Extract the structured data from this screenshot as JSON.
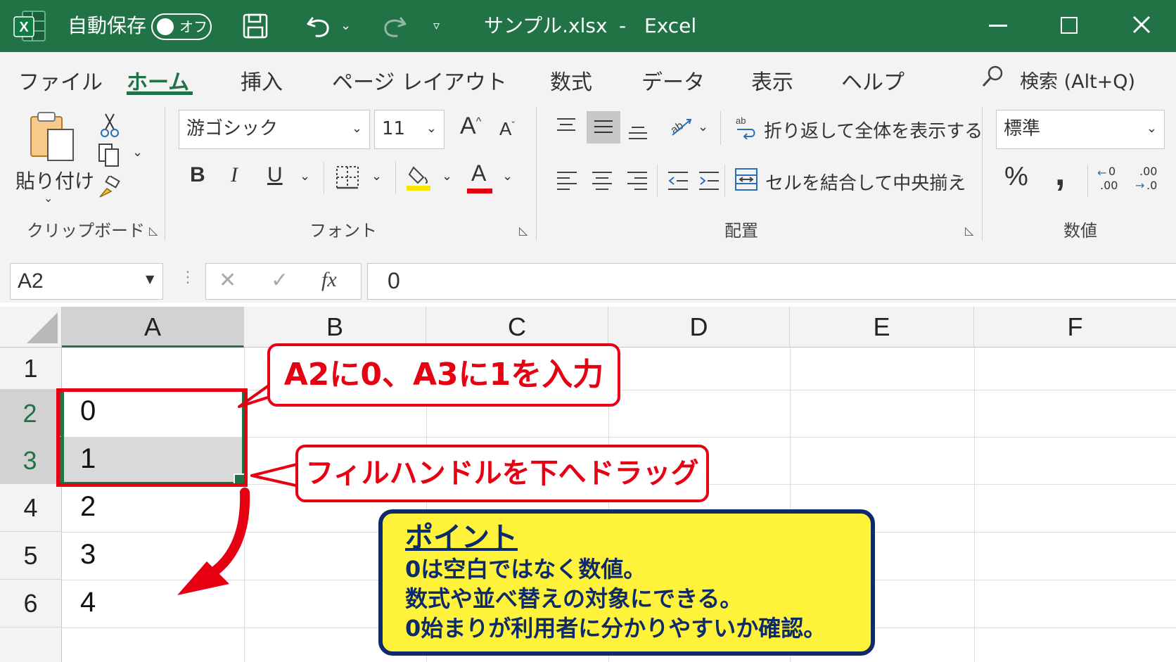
{
  "titlebar": {
    "autosave_label": "自動保存",
    "autosave_state": "オフ",
    "filename": "サンプル.xlsx",
    "separator": "-",
    "app": "Excel"
  },
  "tabs": [
    "ファイル",
    "ホーム",
    "挿入",
    "ページ レイアウト",
    "数式",
    "データ",
    "表示",
    "ヘルプ"
  ],
  "active_tab": "ホーム",
  "search_label": "検索 (Alt+Q)",
  "ribbon": {
    "clipboard": {
      "paste_label": "貼り付け",
      "group_label": "クリップボード"
    },
    "font": {
      "font_name": "游ゴシック",
      "font_size": "11",
      "group_label": "フォント",
      "bold": "B",
      "italic": "I",
      "underline": "U",
      "font_color_letter": "A",
      "highlight_color": "#f6e600",
      "font_color": "#e60012"
    },
    "alignment": {
      "wrap_text": "折り返して全体を表示する",
      "merge_center": "セルを結合して中央揃え",
      "group_label": "配置"
    },
    "number": {
      "format": "標準",
      "percent": "%",
      "comma": ",",
      "dec_inc": ".00",
      "dec_dec": ".0",
      "group_label": "数値"
    }
  },
  "formula_bar": {
    "name_box": "A2",
    "fx": "fx",
    "value": "0"
  },
  "grid": {
    "columns": [
      "A",
      "B",
      "C",
      "D",
      "E",
      "F"
    ],
    "rows": [
      "1",
      "2",
      "3",
      "4",
      "5",
      "6"
    ],
    "column_a_values": [
      "",
      "0",
      "1",
      "2",
      "3",
      "4"
    ],
    "selected_cell": "A2",
    "selected_range": "A2:A3"
  },
  "annotations": {
    "callout1": "A2に0、A3に1を入力",
    "callout2": "フィルハンドルを下へドラッグ",
    "point_title": "ポイント",
    "point_lines": [
      "0は空白ではなく数値。",
      "数式や並べ替えの対象にできる。",
      "0始まりが利用者に分かりやすいか確認。"
    ]
  },
  "colors": {
    "excel_green": "#217346",
    "callout_red": "#e60012",
    "point_yellow": "#fff23a",
    "point_navy": "#0d2a6b"
  }
}
